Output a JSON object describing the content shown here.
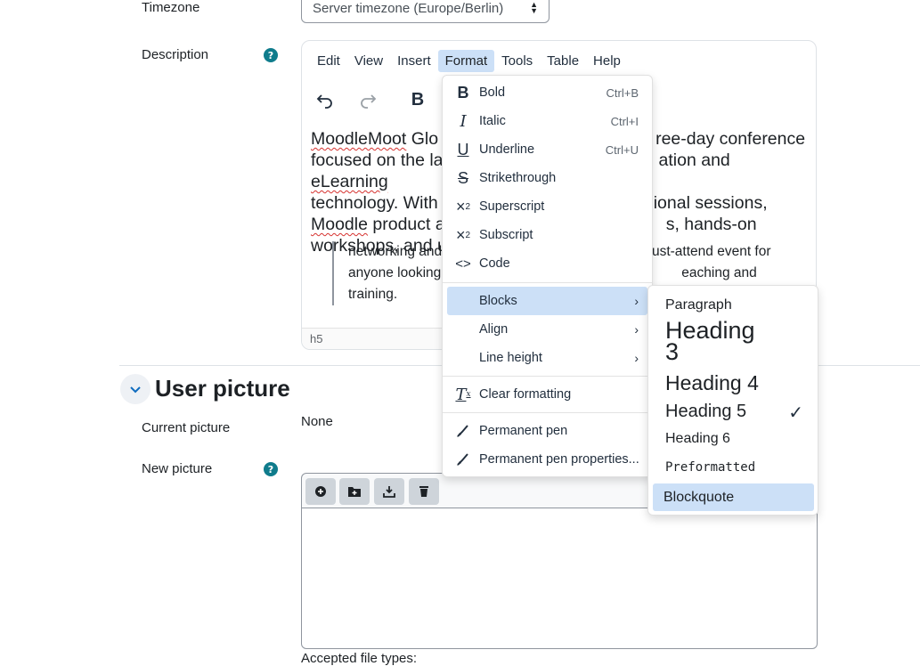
{
  "form": {
    "timezone_label": "Timezone",
    "timezone_value": "Server timezone (Europe/Berlin)",
    "description_label": "Description",
    "current_picture_label": "Current picture",
    "current_picture_value": "None",
    "new_picture_label": "New picture",
    "accepted_types_label": "Accepted file types:",
    "help_glyph": "?"
  },
  "section": {
    "title": "User picture"
  },
  "editor": {
    "menubar": [
      "Edit",
      "View",
      "Insert",
      "Format",
      "Tools",
      "Table",
      "Help"
    ],
    "active_menu": "Format",
    "content": {
      "line1_word": "MoodleMoot",
      "line1a": " Glo",
      "line1b": "ree-day conference",
      "line2a": "focused on the la",
      "line2b": "ation and ",
      "line2_word": "eLearning",
      "line3a": "technology. With",
      "line3b": "ional sessions,",
      "line4_word": "Moodle",
      "line4a": " product a",
      "line4b": "s, hands-on",
      "line5a": "workshops, and u",
      "bq1a": " networking and",
      "bq1b": "a must-attend event for",
      "bq2a": "anyone looking",
      "bq2b": "eaching and training."
    },
    "statusbar_path": "h5"
  },
  "format_menu": {
    "items": [
      {
        "label": "Bold",
        "shortcut": "Ctrl+B",
        "icon": "bold-icon"
      },
      {
        "label": "Italic",
        "shortcut": "Ctrl+I",
        "icon": "italic-icon"
      },
      {
        "label": "Underline",
        "shortcut": "Ctrl+U",
        "icon": "underline-icon"
      },
      {
        "label": "Strikethrough",
        "shortcut": "",
        "icon": "strikethrough-icon"
      },
      {
        "label": "Superscript",
        "shortcut": "",
        "icon": "superscript-icon"
      },
      {
        "label": "Subscript",
        "shortcut": "",
        "icon": "subscript-icon"
      },
      {
        "label": "Code",
        "shortcut": "",
        "icon": "code-icon"
      }
    ],
    "submenus": [
      {
        "label": "Blocks",
        "highlighted": true
      },
      {
        "label": "Align",
        "highlighted": false
      },
      {
        "label": "Line height",
        "highlighted": false
      }
    ],
    "clear_formatting": "Clear formatting",
    "pen_items": [
      "Permanent pen",
      "Permanent pen properties..."
    ]
  },
  "blocks_menu": {
    "items": [
      "Paragraph",
      "Heading 3",
      "Heading 4",
      "Heading 5",
      "Heading 6",
      "Preformatted",
      "Blockquote"
    ],
    "checked": "Heading 5",
    "highlighted": "Blockquote"
  },
  "colors": {
    "highlight": "#cce0f7",
    "help_badge": "#0f7c8c",
    "spellcheck": "#d6322f"
  }
}
